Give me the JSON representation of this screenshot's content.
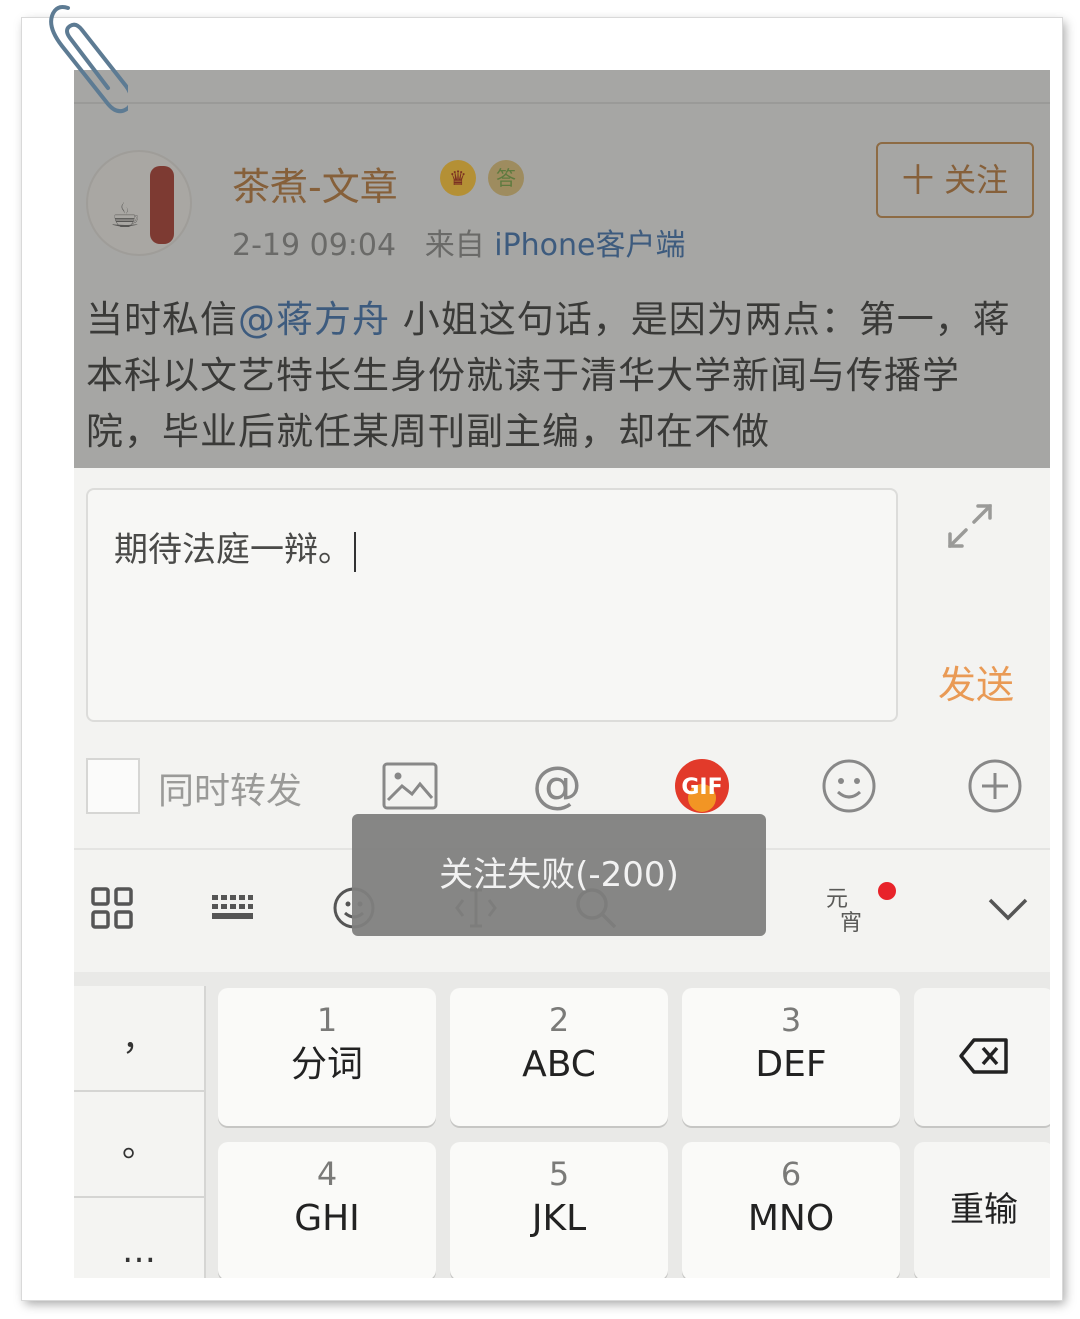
{
  "post": {
    "username": "茶煮-文章",
    "badge_crown_icon": "crown-icon",
    "badge_answer_icon": "answer-badge-icon",
    "time": "2-19 09:04",
    "source_prefix": "来自",
    "source": "iPhone客户端",
    "follow_label": "十 关注",
    "text_before": "当时私信",
    "mention": "@蒋方舟",
    "text_after": " 小姐这句话，是因为两点：第一，蒋本科以文艺特长生身份就读于清华大学新闻与传播学院，毕业后就任某周刊副主编，却在不做"
  },
  "composer": {
    "input_value": "期待法庭一辩。",
    "send_label": "发送",
    "repost_label": "同时转发",
    "tool_icons": [
      "image-icon",
      "at-icon",
      "gif-icon",
      "emoji-icon",
      "plus-icon"
    ]
  },
  "toast": {
    "message": "关注失败(-200)"
  },
  "ime_bar": {
    "yuanxiao_top": "元",
    "yuanxiao_bottom": "宵",
    "icons": [
      "grid-icon",
      "keyboard-icon",
      "emoji-icon",
      "cursor-icon",
      "search-icon",
      "yuanxiao-icon",
      "collapse-icon"
    ]
  },
  "keyboard": {
    "left_column": [
      "，",
      "。",
      "…"
    ],
    "keys": [
      {
        "num": "1",
        "label": "分词"
      },
      {
        "num": "2",
        "label": "ABC"
      },
      {
        "num": "3",
        "label": "DEF"
      },
      {
        "num": "4",
        "label": "GHI"
      },
      {
        "num": "5",
        "label": "JKL"
      },
      {
        "num": "6",
        "label": "MNO"
      }
    ],
    "backspace_icon": "backspace-icon",
    "reenter_label": "重输"
  },
  "colors": {
    "accent_orange": "#e99a55",
    "mention_blue": "#3d5b7e",
    "notification_red": "#e8232a",
    "gif_red": "#e23a2a"
  }
}
